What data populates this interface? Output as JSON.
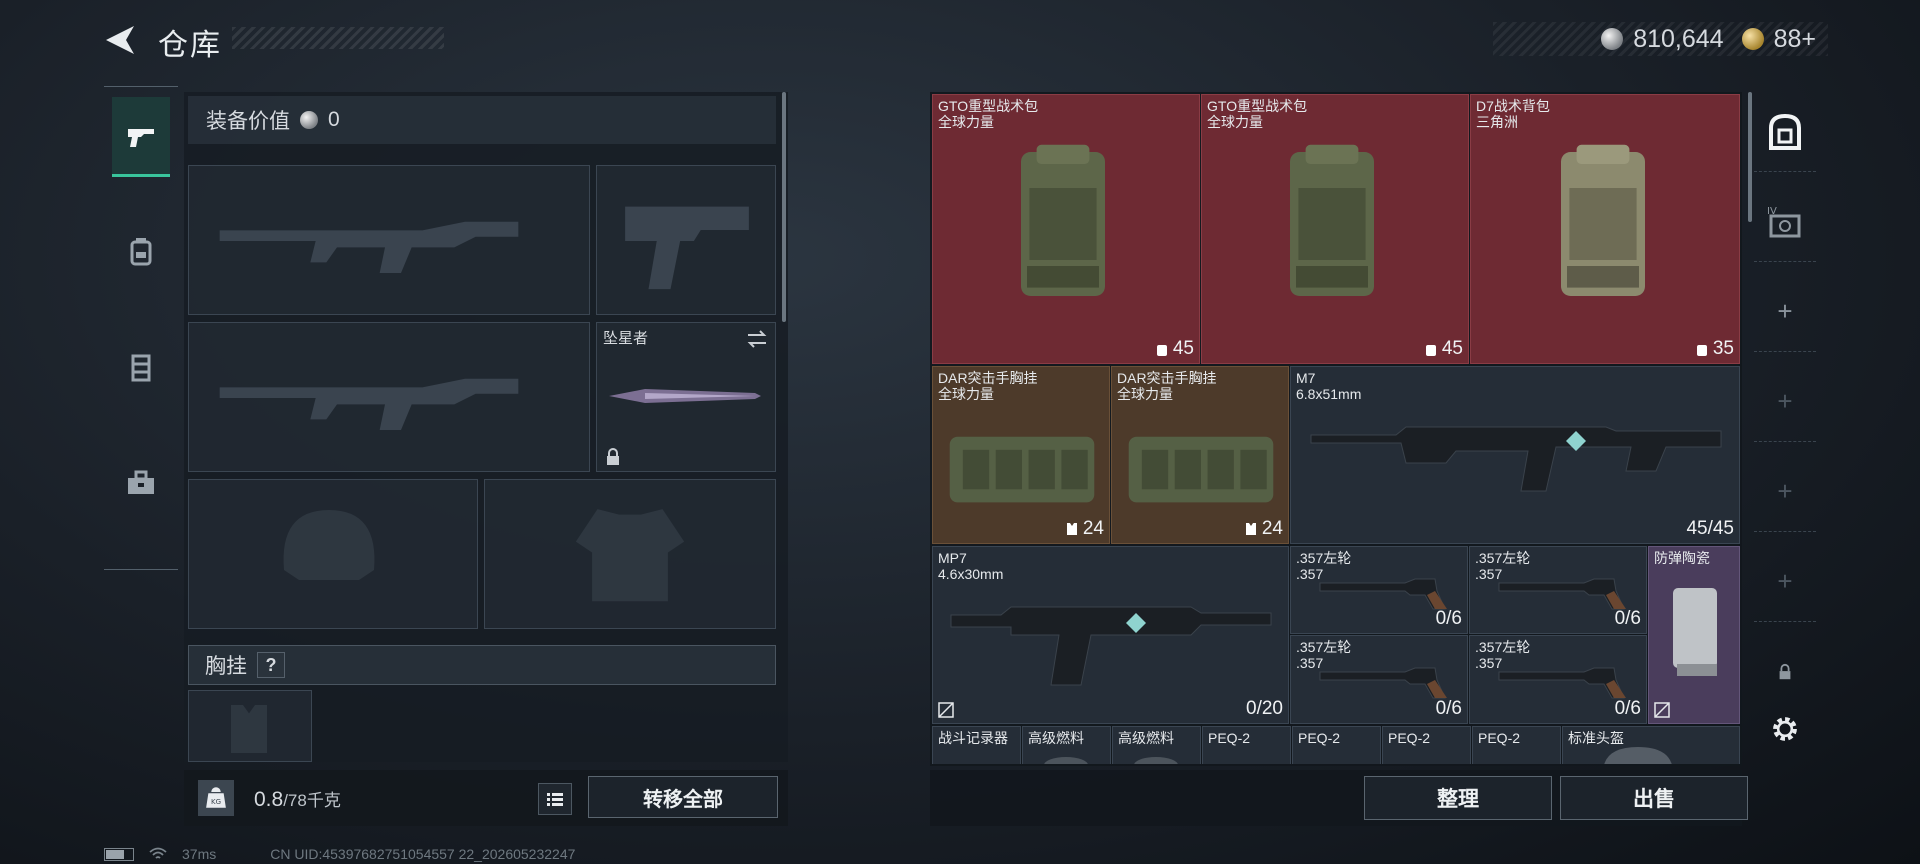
{
  "header": {
    "title": "仓库",
    "currency": {
      "silver": "810,644",
      "gold": "88+"
    }
  },
  "left_tabs": [
    "pistol-tab",
    "backpack-tab",
    "vest-tab",
    "toolbox-tab"
  ],
  "loadout": {
    "equip_value_label": "装备价值",
    "equip_value": "0",
    "melee_name": "坠星者",
    "vest_label": "胸挂",
    "vest_help": "?",
    "weight": "0.8",
    "weight_max": "/78千克",
    "transfer_all": "转移全部"
  },
  "stash": {
    "items": [
      {
        "name": "GTO重型战术包",
        "sub": "全球力量",
        "qty": "45",
        "rarity": "red"
      },
      {
        "name": "GTO重型战术包",
        "sub": "全球力量",
        "qty": "45",
        "rarity": "red"
      },
      {
        "name": "D7战术背包",
        "sub": "三角洲",
        "qty": "35",
        "rarity": "red"
      },
      {
        "name": "DAR突击手胸挂",
        "sub": "全球力量",
        "qty": "24",
        "rarity": "brown"
      },
      {
        "name": "DAR突击手胸挂",
        "sub": "全球力量",
        "qty": "24",
        "rarity": "brown"
      },
      {
        "name": "M7",
        "sub": "6.8x51mm",
        "qty": "45/45",
        "rarity": "dark"
      },
      {
        "name": "MP7",
        "sub": "4.6x30mm",
        "qty": "0/20",
        "rarity": "dark"
      },
      {
        "name": ".357左轮",
        "sub": ".357",
        "qty": "0/6",
        "rarity": "dark"
      },
      {
        "name": ".357左轮",
        "sub": ".357",
        "qty": "0/6",
        "rarity": "dark"
      },
      {
        "name": ".357左轮",
        "sub": ".357",
        "qty": "0/6",
        "rarity": "dark"
      },
      {
        "name": ".357左轮",
        "sub": ".357",
        "qty": "0/6",
        "rarity": "dark"
      },
      {
        "name": "防弹陶瓷",
        "sub": "",
        "qty": "",
        "rarity": "purple"
      },
      {
        "name": "战斗记录器",
        "sub": "",
        "qty": "",
        "rarity": "dark"
      },
      {
        "name": "高级燃料",
        "sub": "",
        "qty": "",
        "rarity": "dark"
      },
      {
        "name": "高级燃料",
        "sub": "",
        "qty": "",
        "rarity": "dark"
      },
      {
        "name": "PEQ-2",
        "sub": "",
        "qty": "",
        "rarity": "dark"
      },
      {
        "name": "PEQ-2",
        "sub": "",
        "qty": "",
        "rarity": "dark"
      },
      {
        "name": "PEQ-2",
        "sub": "",
        "qty": "",
        "rarity": "dark"
      },
      {
        "name": "PEQ-2",
        "sub": "",
        "qty": "",
        "rarity": "dark"
      },
      {
        "name": "标准头盔",
        "sub": "",
        "qty": "",
        "rarity": "dark"
      }
    ],
    "sort_label": "整理",
    "sell_label": "出售"
  },
  "side_tabs": [
    "stash-main-tab",
    "stash-iv-tab",
    "add-tab",
    "add-tab",
    "add-tab",
    "add-tab",
    "lock-tab",
    "settings-tab"
  ],
  "status_bar": {
    "ping": "37ms",
    "uid": "CN UID:45397682751054557 22_202605232247"
  },
  "colors": {
    "accent": "#39c59c",
    "red_rarity": "#6e2a33",
    "brown_rarity": "#4d3a2a",
    "purple_rarity": "#4a3d5c"
  }
}
